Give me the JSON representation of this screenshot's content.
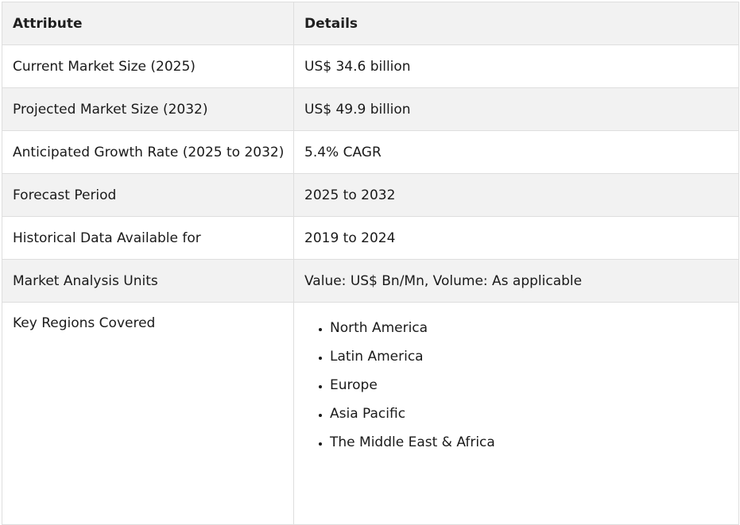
{
  "table": {
    "headers": [
      "Attribute",
      "Details"
    ],
    "rows": [
      {
        "attribute": "Current Market Size (2025)",
        "details": "US$ 34.6 billion"
      },
      {
        "attribute": "Projected Market Size (2032)",
        "details": "US$ 49.9 billion"
      },
      {
        "attribute": "Anticipated Growth Rate (2025 to 2032)",
        "details": "5.4% CAGR"
      },
      {
        "attribute": "Forecast Period",
        "details": "2025 to 2032"
      },
      {
        "attribute": "Historical Data Available for",
        "details": "2019 to 2024"
      },
      {
        "attribute": "Market Analysis Units",
        "details": "Value: US$ Bn/Mn, Volume: As applicable"
      }
    ],
    "regions_row": {
      "attribute": "Key Regions Covered",
      "items": [
        "North America",
        "Latin America",
        "Europe",
        "Asia Pacific",
        "The Middle East & Africa"
      ]
    }
  },
  "colors": {
    "header_bg": "#f2f2f2",
    "alt_row_bg": "#f2f2f2",
    "border": "#dedede",
    "text": "#1a1a1a"
  }
}
